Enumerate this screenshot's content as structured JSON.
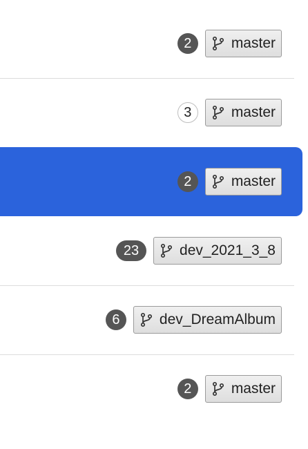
{
  "repos": [
    {
      "count": "2",
      "count_style": "filled",
      "branch": "master"
    },
    {
      "count": "3",
      "count_style": "outline",
      "branch": "master"
    },
    {
      "count": "2",
      "count_style": "filled",
      "branch": "master",
      "selected": true
    },
    {
      "count": "23",
      "count_style": "filled",
      "branch": "dev_2021_3_8"
    },
    {
      "count": "6",
      "count_style": "filled",
      "branch": "dev_DreamAlbum"
    },
    {
      "count": "2",
      "count_style": "filled",
      "branch": "master"
    }
  ],
  "icons": {
    "branch": "git-branch-icon"
  },
  "colors": {
    "selected_bg": "#2b63dc",
    "count_badge": "#555555",
    "branch_border": "#9a9a9a",
    "divider": "#dcdcdc"
  }
}
